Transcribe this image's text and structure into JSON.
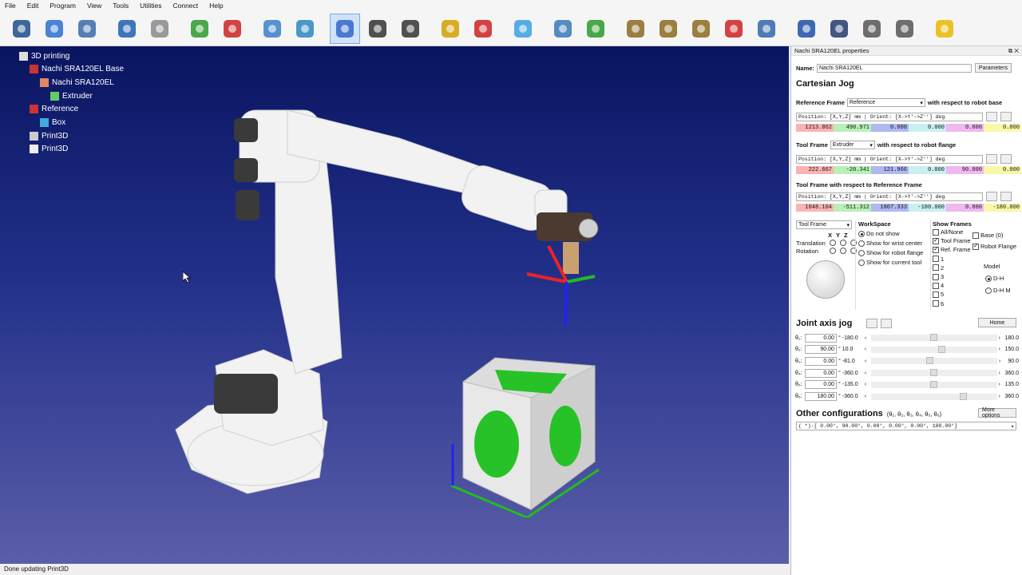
{
  "menu": [
    "File",
    "Edit",
    "Program",
    "View",
    "Tools",
    "Utilities",
    "Connect",
    "Help"
  ],
  "toolbar_icons": [
    "open-icon",
    "globe-icon",
    "save-icon",
    "undo-icon",
    "redo-icon",
    "add-frame-icon",
    "add-target-icon",
    "fit-all-icon",
    "cube-view-icon",
    "select-icon",
    "select-move-icon",
    "select-rotate-icon",
    "collision-icon",
    "collision-flag-icon",
    "fast-forward-icon",
    "python-icon",
    "add-program-icon",
    "move-joint-icon",
    "move-linear-icon",
    "move-circular-icon",
    "pick-icon",
    "place-icon",
    "info-icon",
    "pause-icon",
    "instruction-icon",
    "refresh-icon",
    "package-icon"
  ],
  "tree": [
    {
      "label": "3D printing",
      "indent": 0,
      "icon": "station-icon"
    },
    {
      "label": "Nachi SRA120EL Base",
      "indent": 1,
      "icon": "frame-icon"
    },
    {
      "label": "Nachi SRA120EL",
      "indent": 2,
      "icon": "robot-icon"
    },
    {
      "label": "Extruder",
      "indent": 3,
      "icon": "tool-icon"
    },
    {
      "label": "Reference",
      "indent": 1,
      "icon": "frame-icon"
    },
    {
      "label": "Box",
      "indent": 2,
      "icon": "box-icon"
    },
    {
      "label": "Print3D",
      "indent": 1,
      "icon": "program-icon"
    },
    {
      "label": "Print3D",
      "indent": 1,
      "icon": "script-icon"
    }
  ],
  "status": "Done updating Print3D",
  "panel": {
    "title": "Nachi SRA120EL properties",
    "name_label": "Name:",
    "name_value": "Nachi SRA120EL",
    "parameters_btn": "Parameters",
    "cartesian_jog": "Cartesian Jog",
    "ref_frame_label": "Reference Frame",
    "ref_frame_value": "Reference",
    "ref_frame_suffix": "with respect to robot base",
    "pos_format": "Position: [X,Y,Z] mm | Orient: [X->Y'->Z''] deg",
    "ref_values": [
      "1213.862",
      "490.971",
      "0.000",
      "0.000",
      "0.000",
      "0.000"
    ],
    "tool_frame_label": "Tool Frame",
    "tool_frame_value": "Extruder",
    "tool_frame_suffix": "with respect to robot flange",
    "tool_values": [
      "222.667",
      "-20.341",
      "121.966",
      "0.000",
      "90.000",
      "0.000"
    ],
    "tool_ref_label": "Tool Frame with respect to Reference Frame",
    "toolref_values": [
      "1048.104",
      "-511.312",
      "1807.333",
      "-180.000",
      "0.000",
      "-180.000"
    ],
    "jog_frame": "Tool Frame",
    "xyz": [
      "X",
      "Y",
      "Z"
    ],
    "translation": "Translation",
    "rotation": "Rotation",
    "workspace": "WorkSpace",
    "ws_options": [
      "Do not show",
      "Show for wrist center",
      "Show for robot flange",
      "Show for current tool"
    ],
    "show_frames": "Show Frames",
    "frames_options": [
      {
        "label": "All/None",
        "checked": false
      },
      {
        "label": "Tool Frame",
        "checked": true
      },
      {
        "label": "Ref. Frame",
        "checked": true
      },
      {
        "label": "1",
        "checked": false
      },
      {
        "label": "2",
        "checked": false
      },
      {
        "label": "3",
        "checked": false
      },
      {
        "label": "4",
        "checked": false
      },
      {
        "label": "5",
        "checked": false
      },
      {
        "label": "6",
        "checked": false
      }
    ],
    "base_label": "Base (0)",
    "robot_flange_label": "Robot Flange",
    "model_label": "Model",
    "model_opts": [
      "D-H",
      "D-H M"
    ],
    "joint_jog": "Joint axis jog",
    "home_btn": "Home",
    "joints": [
      {
        "label": "θ₁:",
        "value": "0.00",
        "min": "-180.0",
        "max": "180.0",
        "frac": 0.5
      },
      {
        "label": "θ₂:",
        "value": "90.00",
        "min": "10.0",
        "max": "150.0",
        "frac": 0.57
      },
      {
        "label": "θ₃:",
        "value": "0.00",
        "min": "-81.0",
        "max": "90.0",
        "frac": 0.47
      },
      {
        "label": "θ₄:",
        "value": "0.00",
        "min": "-360.0",
        "max": "360.0",
        "frac": 0.5
      },
      {
        "label": "θ₅:",
        "value": "0.00",
        "min": "-135.0",
        "max": "135.0",
        "frac": 0.5
      },
      {
        "label": "θ₆:",
        "value": "180.00",
        "min": "-360.0",
        "max": "360.0",
        "frac": 0.75
      }
    ],
    "deg": "°",
    "other_conf": "Other configurations",
    "other_conf_sub": "(θ₁, θ₂, θ₃, θ₄, θ₅, θ₆)",
    "more_options": "More options",
    "conf_value": "( *)-[   0.00°,  90.00°,   0.00°,   0.00°,   0.00°, 180.00°]"
  }
}
